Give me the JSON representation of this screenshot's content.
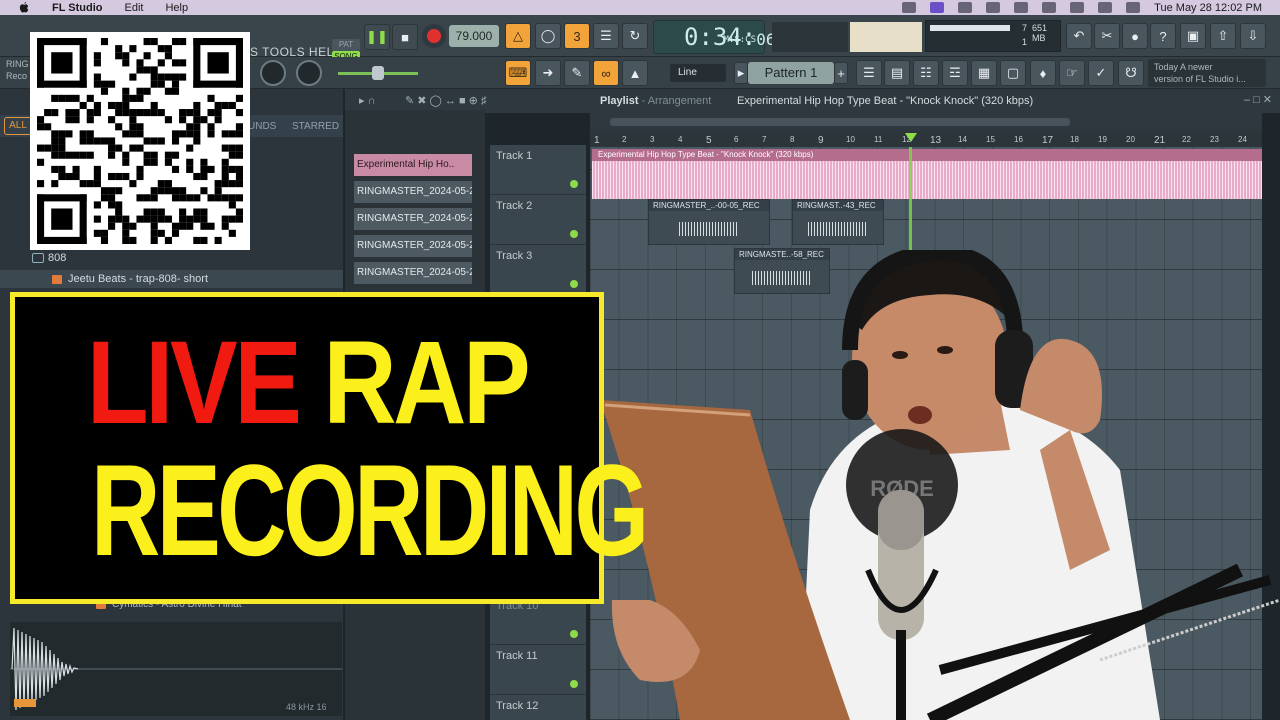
{
  "menubar": {
    "app_name": "FL Studio",
    "menu_edit": "Edit",
    "menu_help": "Help",
    "datetime": "Tue May 28  12:02 PM"
  },
  "toolbar": {
    "menu_tools_help": "S TOOLS  HELP",
    "pat_label": "PAT",
    "song_label": "SONG",
    "tempo": "79.000",
    "time_main": "0:34:",
    "time_sub": "06",
    "time_unit": "M:S:CS",
    "cpu_value": "7",
    "mem_value": "651 MB",
    "poly_value": "1",
    "mode_line": "Line",
    "pattern": "Pattern 1",
    "news_line1": "Today  A newer",
    "news_line2": "version of FL Studio i..."
  },
  "browser": {
    "top_label1": "RING",
    "top_label2": "Reco",
    "tab_all": "ALL",
    "tab_sounds": "UNDS",
    "tab_starred": "STARRED",
    "folder_808": "808",
    "item_selected": "Jeetu Beats - trap-808- short",
    "item_bottom1": "Cymatics - Astro Divine Hihat",
    "sample_rate": "48 kHz 16"
  },
  "channels": [
    "Experimental Hip Ho..",
    "RINGMASTER_2024-05-2..",
    "RINGMASTER_2024-05-2..",
    "RINGMASTER_2024-05-2..",
    "RINGMASTER_2024-05-2.."
  ],
  "playlist": {
    "title": "Playlist",
    "subtitle": "- Arrangement",
    "song_name": "Experimental Hip Hop Type Beat - \"Knock Knock\" (320 kbps)",
    "main_clip_label": "Experimental Hip Hop Type Beat - \"Knock Knock\" (320 kbps)",
    "clips": [
      "RINGMASTER_..-00-05_REC",
      "RINGMAST..-43_REC",
      "RINGMASTE..-58_REC"
    ],
    "tracks": [
      "Track 1",
      "Track 2",
      "Track 3",
      "Track 10",
      "Track 11",
      "Track 12"
    ],
    "bars": [
      "1",
      "2",
      "3",
      "4",
      "5",
      "6",
      "7",
      "8",
      "9",
      "10",
      "11",
      "12",
      "13",
      "14",
      "15",
      "16",
      "17",
      "18",
      "19",
      "20",
      "21",
      "22",
      "23",
      "24"
    ]
  },
  "overlay": {
    "word_live": "LIVE",
    "word_rap": "RAP",
    "word_recording": "RECORDING",
    "mic_brand": "RØDE"
  },
  "colors": {
    "title_yellow": "#fcf01c",
    "title_red": "#f01a10",
    "accent_orange": "#f2a43a",
    "clip_pink": "#f3c6de"
  }
}
